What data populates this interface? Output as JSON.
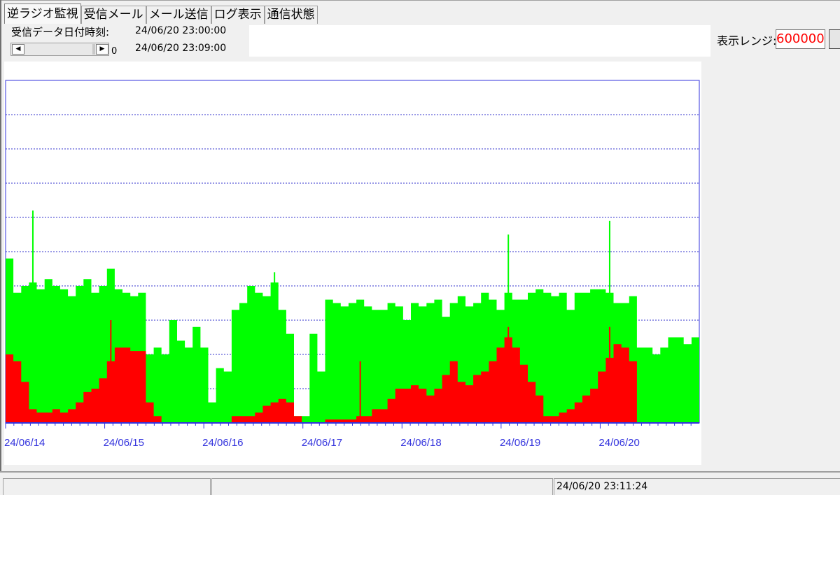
{
  "tabs": [
    {
      "label": "逆ラジオ監視",
      "active": true
    },
    {
      "label": "受信メール",
      "active": false
    },
    {
      "label": "メール送信",
      "active": false
    },
    {
      "label": "ログ表示",
      "active": false
    },
    {
      "label": "通信状態",
      "active": false
    }
  ],
  "received": {
    "label": "受信データ日付時刻:",
    "time1": "24/06/20 23:00:00",
    "time2": "24/06/20 23:09:00"
  },
  "scrollbar": {
    "value": "0"
  },
  "range": {
    "label": "表示レンジ:",
    "value": "600000"
  },
  "status": {
    "pane1": "",
    "pane2": "",
    "datetime": "24/06/20 23:11:24"
  },
  "colors": {
    "series_total": "#00ff00",
    "series_red": "#ff0000",
    "axis": "#3333dd",
    "grid": "#3333cc"
  },
  "chart_data": {
    "type": "area",
    "title": "",
    "xlabel": "",
    "ylabel": "",
    "x": [
      "24/06/14",
      "24/06/15",
      "24/06/16",
      "24/06/17",
      "24/06/18",
      "24/06/19",
      "24/06/20"
    ],
    "grid": true,
    "gridlines": 9,
    "ylim": [
      0,
      1
    ],
    "samples_note": "",
    "series": [
      {
        "name": "",
        "color": "#00ff00",
        "values": [
          0.48,
          0.38,
          0.4,
          0.41,
          0.39,
          0.42,
          0.4,
          0.39,
          0.37,
          0.4,
          0.42,
          0.38,
          0.4,
          0.45,
          0.39,
          0.38,
          0.37,
          0.38,
          0.2,
          0.22,
          0.2,
          0.3,
          0.24,
          0.22,
          0.28,
          0.22,
          0.06,
          0.16,
          0.15,
          0.33,
          0.35,
          0.4,
          0.38,
          0.37,
          0.41,
          0.33,
          0.26,
          0.02,
          0.02,
          0.26,
          0.15,
          0.36,
          0.35,
          0.34,
          0.35,
          0.36,
          0.34,
          0.33,
          0.33,
          0.35,
          0.34,
          0.3,
          0.35,
          0.34,
          0.35,
          0.36,
          0.31,
          0.35,
          0.37,
          0.34,
          0.35,
          0.38,
          0.36,
          0.33,
          0.38,
          0.36,
          0.36,
          0.38,
          0.39,
          0.38,
          0.37,
          0.38,
          0.33,
          0.38,
          0.38,
          0.39,
          0.39,
          0.38,
          0.35,
          0.35,
          0.37,
          0.22,
          0.22,
          0.2,
          0.22,
          0.25,
          0.25,
          0.23,
          0.25
        ],
        "spikes": [
          [
            3,
            0.62
          ],
          [
            34,
            0.44
          ],
          [
            42,
            0.33
          ],
          [
            64,
            0.55
          ],
          [
            77,
            0.59
          ]
        ]
      },
      {
        "name": "",
        "color": "#ff0000",
        "values": [
          0.2,
          0.18,
          0.12,
          0.04,
          0.03,
          0.03,
          0.04,
          0.03,
          0.04,
          0.06,
          0.09,
          0.1,
          0.13,
          0.18,
          0.22,
          0.22,
          0.21,
          0.21,
          0.06,
          0.02,
          0.0,
          0.0,
          0.0,
          0.0,
          0.0,
          0.0,
          0.0,
          0.0,
          0.0,
          0.02,
          0.02,
          0.02,
          0.03,
          0.05,
          0.06,
          0.07,
          0.06,
          0.02,
          0.0,
          0.0,
          0.0,
          0.01,
          0.01,
          0.01,
          0.01,
          0.02,
          0.02,
          0.04,
          0.04,
          0.07,
          0.1,
          0.1,
          0.11,
          0.1,
          0.08,
          0.1,
          0.14,
          0.18,
          0.12,
          0.11,
          0.14,
          0.15,
          0.18,
          0.22,
          0.25,
          0.22,
          0.17,
          0.12,
          0.08,
          0.02,
          0.02,
          0.03,
          0.04,
          0.06,
          0.08,
          0.1,
          0.15,
          0.19,
          0.23,
          0.22,
          0.18,
          0.0,
          0.0,
          0.0,
          0.0,
          0.0,
          0.0,
          0.0,
          0.0
        ],
        "spikes": [
          [
            13,
            0.3
          ],
          [
            45,
            0.18
          ],
          [
            64,
            0.28
          ],
          [
            77,
            0.28
          ]
        ]
      }
    ]
  }
}
